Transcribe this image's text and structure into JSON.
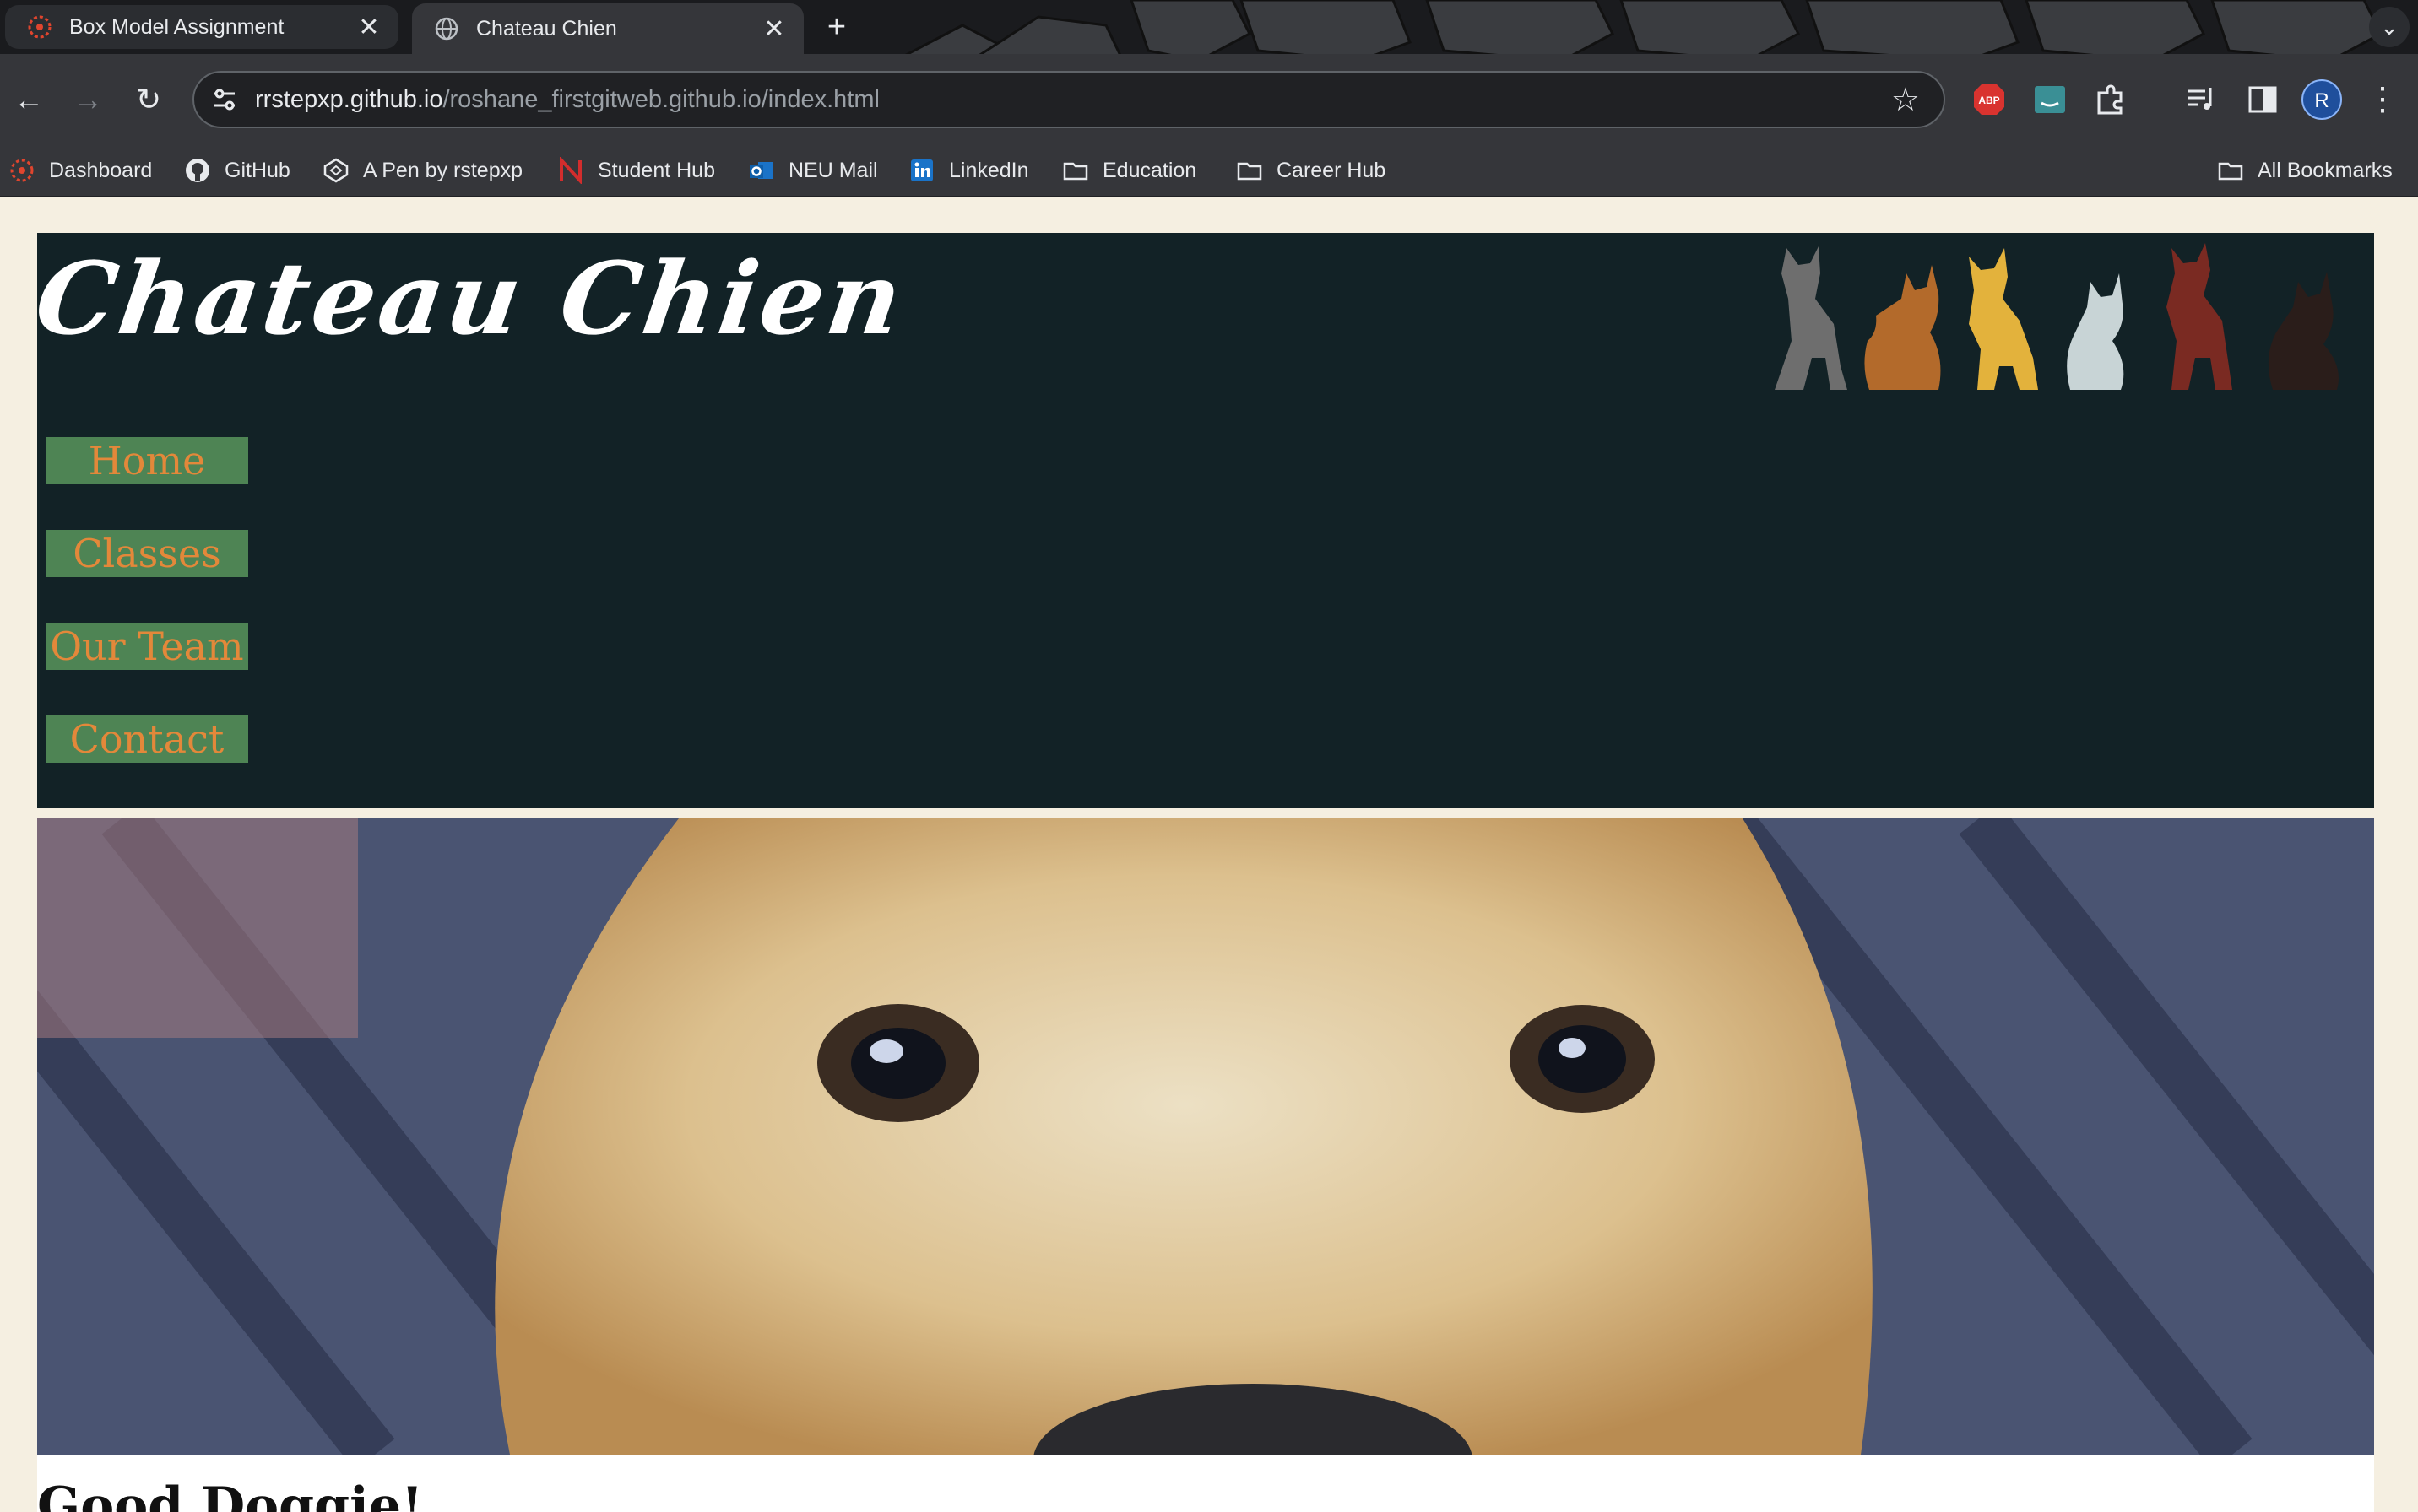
{
  "browser": {
    "tabs": [
      {
        "title": "Box Model Assignment",
        "active": false
      },
      {
        "title": "Chateau Chien",
        "active": true
      }
    ],
    "close_glyph": "✕",
    "new_tab_glyph": "+",
    "tab_search_glyph": "⌄",
    "nav": {
      "back": "←",
      "forward": "→",
      "reload": "↻"
    },
    "url": {
      "host": "rrstepxp.github.io",
      "path": "/roshane_firstgitweb.github.io/index.html"
    },
    "star_glyph": "☆",
    "extensions": [
      "adblock-plus-icon",
      "amazon-assistant-icon",
      "puzzle-extensions-icon",
      "media-controls-icon",
      "side-panel-icon"
    ],
    "profile_initial": "R",
    "menu_glyph": "⋮",
    "bookmarks": [
      {
        "label": "Dashboard",
        "icon": "canvas-dashboard-icon"
      },
      {
        "label": "GitHub",
        "icon": "github-icon"
      },
      {
        "label": "A Pen by rstepxp",
        "icon": "codepen-icon"
      },
      {
        "label": "Student Hub",
        "icon": "student-hub-icon"
      },
      {
        "label": "NEU Mail",
        "icon": "outlook-icon"
      },
      {
        "label": "LinkedIn",
        "icon": "linkedin-icon"
      },
      {
        "label": "Education",
        "icon": "folder-icon"
      },
      {
        "label": "Career Hub",
        "icon": "folder-icon"
      }
    ],
    "all_bookmarks": "All Bookmarks"
  },
  "site": {
    "logo": "Chateau Chien",
    "nav": [
      "Home",
      "Classes",
      "Our Team",
      "Contact"
    ],
    "section_heading": "Good Doggie!"
  },
  "colors": {
    "header_bg": "#122226",
    "nav_bg": "#4e8454",
    "nav_text": "#e3883a",
    "page_bg": "#f5efe1"
  }
}
